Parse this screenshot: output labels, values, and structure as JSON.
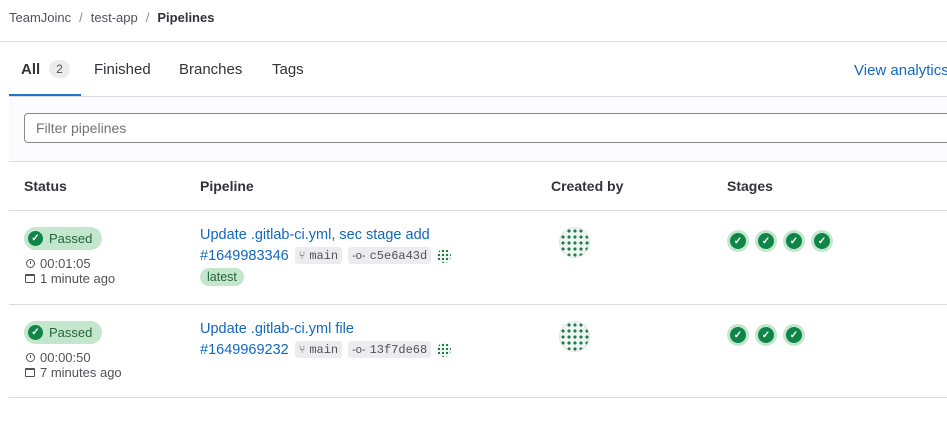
{
  "breadcrumb": {
    "group": "TeamJoinc",
    "project": "test-app",
    "current": "Pipelines",
    "separator": "/"
  },
  "tabs": [
    {
      "label": "All",
      "count": "2",
      "active": true
    },
    {
      "label": "Finished"
    },
    {
      "label": "Branches"
    },
    {
      "label": "Tags"
    }
  ],
  "view_analytics": "View analytics",
  "filter": {
    "placeholder": "Filter pipelines"
  },
  "columns": {
    "status": "Status",
    "pipeline": "Pipeline",
    "created_by": "Created by",
    "stages": "Stages"
  },
  "rows": [
    {
      "status": "Passed",
      "duration": "00:01:05",
      "finished": "1 minute ago",
      "title": "Update .gitlab-ci.yml, sec stage add",
      "id": "#1649983346",
      "ref": "main",
      "commit": "c5e6a43d",
      "tag": "latest",
      "stages_passed": 4
    },
    {
      "status": "Passed",
      "duration": "00:00:50",
      "finished": "7 minutes ago",
      "title": "Update .gitlab-ci.yml file",
      "id": "#1649969232",
      "ref": "main",
      "commit": "13f7de68",
      "stages_passed": 3
    }
  ],
  "colors": {
    "accent": "#1f75cb",
    "link": "#1068bf",
    "success": "#108548",
    "success_bg": "#c3e6cd"
  },
  "icons": {
    "status": "check-circle-icon",
    "duration": "timer-icon",
    "finished": "calendar-icon",
    "ref": "branch-icon",
    "commit": "commit-icon"
  }
}
